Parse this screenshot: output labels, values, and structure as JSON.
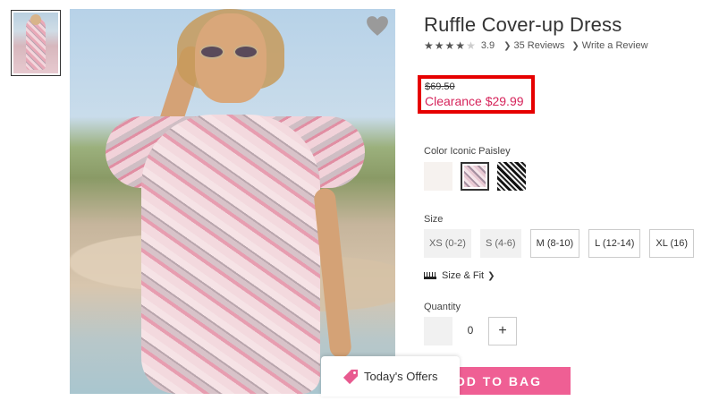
{
  "product": {
    "title": "Ruffle Cover-up Dress",
    "rating": 3.9,
    "rating_text": "3.9",
    "stars_filled": 4,
    "stars_total": 5,
    "reviews_link": "35 Reviews",
    "write_review_link": "Write a Review",
    "original_price": "$69.50",
    "sale_price": "Clearance $29.99"
  },
  "color": {
    "label": "Color Iconic Paisley",
    "swatches": [
      "white",
      "iconic-paisley",
      "black-white"
    ],
    "selected": "iconic-paisley"
  },
  "size": {
    "label": "Size",
    "options": [
      "XS (0-2)",
      "S (4-6)",
      "M (8-10)",
      "L (12-14)",
      "XL (16)"
    ],
    "unavailable": [
      "XS (0-2)",
      "S (4-6)"
    ]
  },
  "size_fit_link": "Size & Fit",
  "quantity": {
    "label": "Quantity",
    "value": "0",
    "plus": "+"
  },
  "add_to_bag_label": "ADD TO BAG",
  "offers_label": "Today's Offers",
  "colors": {
    "accent_pink": "#ef5f94",
    "sale_red": "#d6245b",
    "highlight_box": "#e60000"
  },
  "icons": {
    "favorite": "heart-icon",
    "rating": "star-icon",
    "link_chevron": "chevron-right-icon",
    "size_fit": "ruler-icon",
    "offers": "tag-icon"
  }
}
